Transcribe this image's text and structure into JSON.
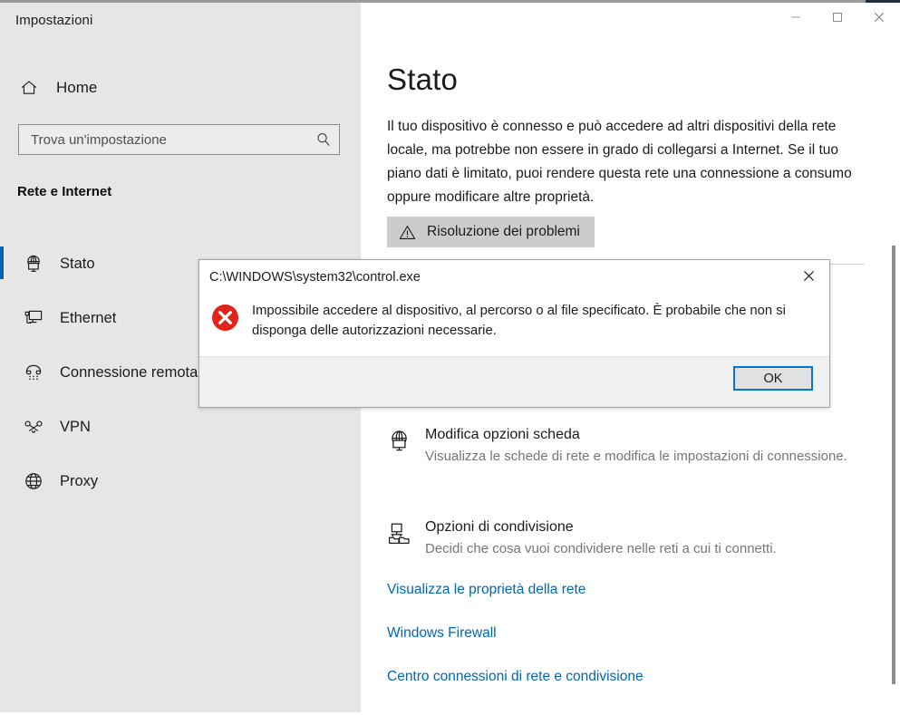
{
  "app": {
    "title": "Impostazioni"
  },
  "titlebar": {
    "minimize": "minimize-icon",
    "maximize": "maximize-icon",
    "close": "close-icon"
  },
  "sidebar": {
    "home_label": "Home",
    "home_icon": "home-icon",
    "search": {
      "placeholder": "Trova un'impostazione",
      "value": "",
      "icon": "search-icon"
    },
    "section_title": "Rete e Internet",
    "items": [
      {
        "label": "Stato",
        "icon": "network-status-icon",
        "selected": true
      },
      {
        "label": "Ethernet",
        "icon": "ethernet-icon",
        "selected": false
      },
      {
        "label": "Connessione remota",
        "icon": "dialup-phone-icon",
        "selected": false
      },
      {
        "label": "VPN",
        "icon": "vpn-key-icon",
        "selected": false
      },
      {
        "label": "Proxy",
        "icon": "globe-icon",
        "selected": false
      }
    ]
  },
  "main": {
    "page_title": "Stato",
    "status_description": "Il tuo dispositivo è connesso e può accedere ad altri dispositivi della rete locale, ma potrebbe non essere in grado di collegarsi a Internet. Se il tuo piano dati è limitato, puoi rendere questa rete una connessione a consumo oppure modificare altre proprietà.",
    "troubleshoot_button": {
      "label": "Risoluzione dei problemi",
      "icon": "warning-triangle-icon"
    },
    "options": [
      {
        "title": "Modifica opzioni scheda",
        "subtitle": "Visualizza le schede di rete e modifica le impostazioni di connessione.",
        "icon": "network-adapter-icon"
      },
      {
        "title": "Opzioni di condivisione",
        "subtitle": "Decidi che cosa vuoi condividere nelle reti a cui ti connetti.",
        "icon": "sharing-folder-icon"
      }
    ],
    "links": [
      "Visualizza le proprietà della rete",
      "Windows Firewall",
      "Centro connessioni di rete e condivisione"
    ]
  },
  "dialog": {
    "title": "C:\\WINDOWS\\system32\\control.exe",
    "message": "Impossibile accedere al dispositivo, al percorso o al file specificato. È probabile che non si disponga delle autorizzazioni necessarie.",
    "ok_label": "OK",
    "error_icon": "error-circle-x-icon",
    "close_icon": "close-icon"
  },
  "colors": {
    "accent_blue": "#0062b1",
    "link_blue": "#0067b8",
    "error_red": "#e81123",
    "focus_blue": "#0078d7",
    "sidebar_bg": "#e6e6e6"
  }
}
